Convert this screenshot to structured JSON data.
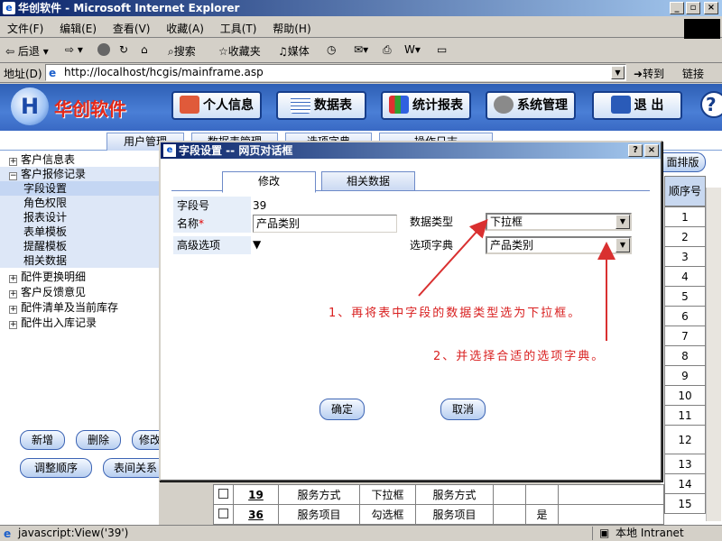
{
  "window": {
    "title": "华创软件 - Microsoft Internet Explorer"
  },
  "menu": [
    "文件(F)",
    "编辑(E)",
    "查看(V)",
    "收藏(A)",
    "工具(T)",
    "帮助(H)"
  ],
  "toolbar": {
    "back": "后退",
    "search": "搜索",
    "favorites": "收藏夹",
    "media": "媒体"
  },
  "address": {
    "label": "地址(D)",
    "url": "http://localhost/hcgis/mainframe.asp",
    "go": "转到",
    "links": "链接"
  },
  "app": {
    "name": "华创软件",
    "nav": [
      "个人信息",
      "数据表",
      "统计报表",
      "系统管理",
      "退 出"
    ],
    "subtabs": [
      "用户管理",
      "数据表管理",
      "选项字典",
      "操作日志"
    ]
  },
  "tree": {
    "items": [
      {
        "label": "客户信息表",
        "expander": "+"
      },
      {
        "label": "客户报修记录",
        "expander": "−"
      }
    ],
    "subitems": [
      "字段设置",
      "角色权限",
      "报表设计",
      "表单模板",
      "提醒模板",
      "相关数据"
    ],
    "items_after": [
      {
        "label": "配件更换明细",
        "expander": "+"
      },
      {
        "label": "客户反馈意见",
        "expander": "+"
      },
      {
        "label": "配件清单及当前库存",
        "expander": "+"
      },
      {
        "label": "配件出入库记录",
        "expander": "+"
      }
    ]
  },
  "leftbuttons": {
    "add": "新增",
    "delete": "删除",
    "edit": "修改",
    "reorder": "调整顺序",
    "relations": "表间关系"
  },
  "right": {
    "sort_button": "面排版",
    "header": "顺序号",
    "orders": [
      "1",
      "2",
      "3",
      "4",
      "5",
      "6",
      "7",
      "8",
      "9",
      "10",
      "11",
      "12",
      "13",
      "14",
      "15"
    ]
  },
  "table_rows": [
    {
      "id": "19",
      "name": "服务方式",
      "type": "下拉框",
      "dict": "服务方式",
      "flag": "",
      "order": "14"
    },
    {
      "id": "36",
      "name": "服务项目",
      "type": "勾选框",
      "dict": "服务项目",
      "flag": "是",
      "order": "15"
    }
  ],
  "dialog": {
    "title": "字段设置 -- 网页对话框",
    "tabs": [
      "修改",
      "相关数据"
    ],
    "field_no_label": "字段号",
    "field_no": "39",
    "name_label": "名称",
    "required_mark": "*",
    "name_value": "产品类别",
    "datatype_label": "数据类型",
    "datatype_value": "下拉框",
    "advanced_label": "高级选项",
    "dict_label": "选项字典",
    "dict_value": "产品类别",
    "annotation1": "1、再将表中字段的数据类型选为下拉框。",
    "annotation2": "2、并选择合适的选项字典。",
    "ok": "确定",
    "cancel": "取消"
  },
  "status": {
    "text": "javascript:View('39')",
    "zone": "本地 Intranet"
  }
}
